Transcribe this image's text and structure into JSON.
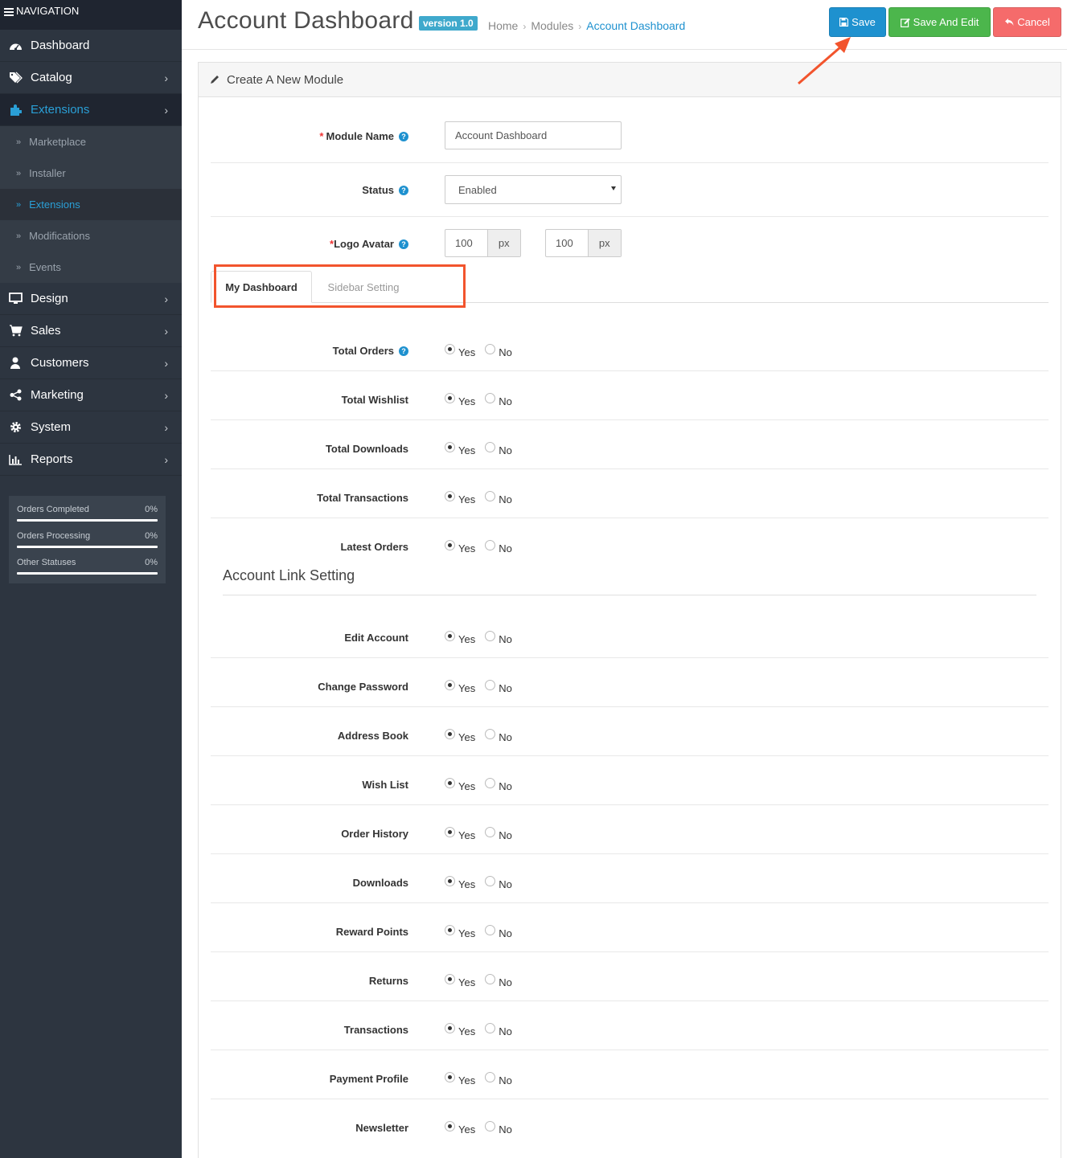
{
  "nav": {
    "header": "NAVIGATION",
    "items": [
      {
        "label": "Dashboard",
        "icon": "dashboard-icon"
      },
      {
        "label": "Catalog",
        "icon": "tags-icon"
      },
      {
        "label": "Extensions",
        "icon": "puzzle-icon"
      },
      {
        "label": "Design",
        "icon": "desktop-icon"
      },
      {
        "label": "Sales",
        "icon": "cart-icon"
      },
      {
        "label": "Customers",
        "icon": "user-icon"
      },
      {
        "label": "Marketing",
        "icon": "share-icon"
      },
      {
        "label": "System",
        "icon": "gear-icon"
      },
      {
        "label": "Reports",
        "icon": "bar-chart-icon"
      }
    ],
    "sub_items": [
      "Marketplace",
      "Installer",
      "Extensions",
      "Modifications",
      "Events"
    ],
    "stats": [
      {
        "label": "Orders Completed",
        "value": "0%",
        "fraction": 0
      },
      {
        "label": "Orders Processing",
        "value": "0%",
        "fraction": 0
      },
      {
        "label": "Other Statuses",
        "value": "0%",
        "fraction": 0
      }
    ]
  },
  "header": {
    "title": "Account Dashboard",
    "version": "version 1.0",
    "breadcrumb": [
      "Home",
      "Modules",
      "Account Dashboard"
    ],
    "save": "Save",
    "save_edit": "Save And Edit",
    "cancel": "Cancel"
  },
  "panel": {
    "title": "Create A New Module",
    "module_name_label": "Module Name",
    "module_name_value": "Account Dashboard",
    "status_label": "Status",
    "status_value": "Enabled",
    "logo_label": "Logo Avatar",
    "logo_width": "100",
    "logo_height": "100",
    "unit": "px",
    "tabs": [
      "My Dashboard",
      "Sidebar Setting"
    ],
    "yes": "Yes",
    "no": "No",
    "dashboard_rows": [
      "Total Orders",
      "Total Wishlist",
      "Total Downloads",
      "Total Transactions",
      "Latest Orders"
    ],
    "section_title": "Account Link Setting",
    "link_rows": [
      "Edit Account",
      "Change Password",
      "Address Book",
      "Wish List",
      "Order History",
      "Downloads",
      "Reward Points",
      "Returns",
      "Transactions",
      "Payment Profile",
      "Newsletter"
    ]
  },
  "colors": {
    "accent": "#1e91cf",
    "success": "#4cb64c",
    "danger": "#f56b6b",
    "highlight": "#f2542d",
    "sidebar": "#2d3540"
  }
}
